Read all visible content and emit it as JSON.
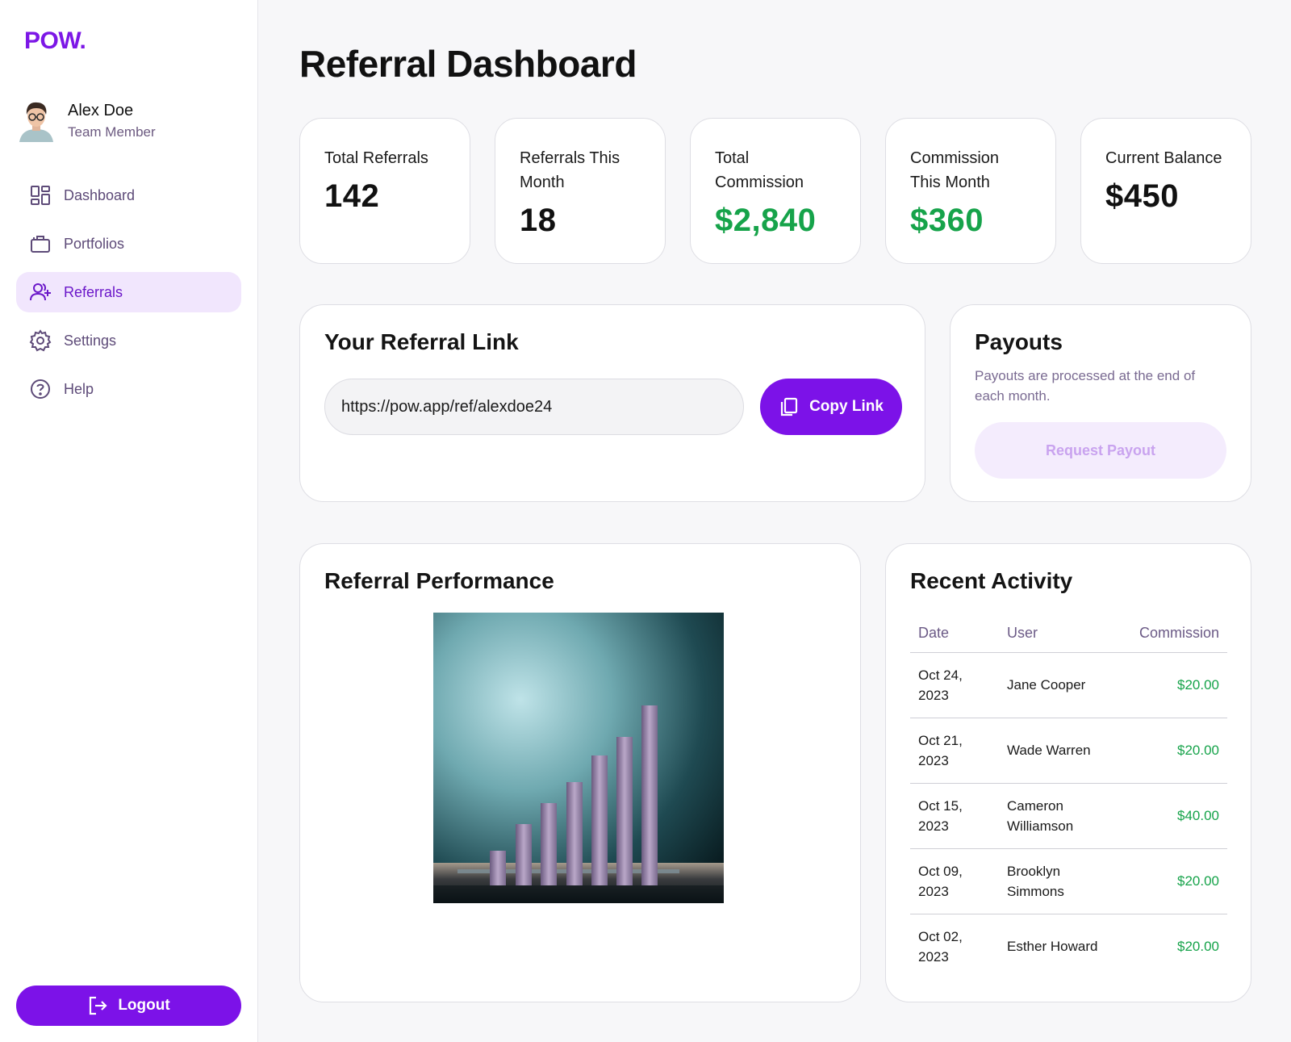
{
  "app": {
    "logo": "POW."
  },
  "user": {
    "name": "Alex Doe",
    "role": "Team Member"
  },
  "nav": {
    "items": [
      {
        "label": "Dashboard",
        "icon": "dashboard-icon"
      },
      {
        "label": "Portfolios",
        "icon": "briefcase-icon"
      },
      {
        "label": "Referrals",
        "icon": "user-plus-icon",
        "active": true
      },
      {
        "label": "Settings",
        "icon": "gear-icon"
      },
      {
        "label": "Help",
        "icon": "help-circle-icon"
      }
    ],
    "logout_label": "Logout"
  },
  "page": {
    "title": "Referral Dashboard"
  },
  "stats": [
    {
      "label": "Total Referrals",
      "value": "142"
    },
    {
      "label": "Referrals This Month",
      "value": "18"
    },
    {
      "label": "Total Commission",
      "value": "$2,840"
    },
    {
      "label": "Commission This Month",
      "value": "$360"
    },
    {
      "label": "Current Balance",
      "value": "$450"
    }
  ],
  "referral_link": {
    "title": "Your Referral Link",
    "url": "https://pow.app/ref/alexdoe24",
    "copy_label": "Copy Link"
  },
  "payouts": {
    "title": "Payouts",
    "description": "Payouts are processed at the end of each month.",
    "button_label": "Request Payout"
  },
  "performance": {
    "title": "Referral Performance"
  },
  "activity": {
    "title": "Recent Activity",
    "columns": [
      "Date",
      "User",
      "Commission"
    ],
    "rows": [
      {
        "date": "Oct 24, 2023",
        "user": "Jane Cooper",
        "commission": "$20.00"
      },
      {
        "date": "Oct 21, 2023",
        "user": "Wade Warren",
        "commission": "$20.00"
      },
      {
        "date": "Oct 15, 2023",
        "user": "Cameron Williamson",
        "commission": "$40.00"
      },
      {
        "date": "Oct 09, 2023",
        "user": "Brooklyn Simmons",
        "commission": "$20.00"
      },
      {
        "date": "Oct 02, 2023",
        "user": "Esther Howard",
        "commission": "$20.00"
      }
    ]
  },
  "colors": {
    "accent": "#7c12e8",
    "accent_light": "#f1e6fd",
    "positive": "#16a34a",
    "background": "#f7f7f9"
  }
}
